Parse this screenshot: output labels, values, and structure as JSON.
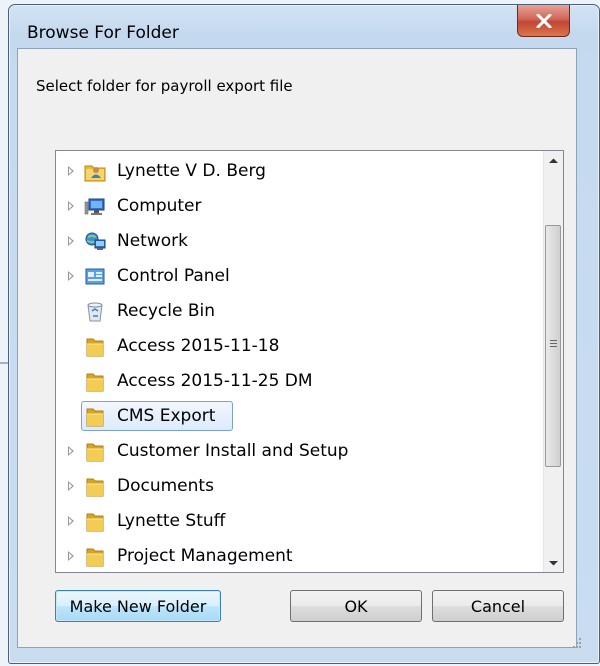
{
  "window": {
    "title": "Browse For Folder",
    "close_glyph": "X"
  },
  "prompt": "Select folder for payroll export file",
  "tree": {
    "items": [
      {
        "label": "Lynette V D. Berg",
        "icon": "user-folder-icon",
        "expandable": true,
        "selected": false
      },
      {
        "label": "Computer",
        "icon": "computer-icon",
        "expandable": true,
        "selected": false
      },
      {
        "label": "Network",
        "icon": "network-icon",
        "expandable": true,
        "selected": false
      },
      {
        "label": "Control Panel",
        "icon": "control-panel-icon",
        "expandable": true,
        "selected": false
      },
      {
        "label": "Recycle Bin",
        "icon": "recycle-bin-icon",
        "expandable": false,
        "selected": false
      },
      {
        "label": "Access 2015-11-18",
        "icon": "folder-icon",
        "expandable": false,
        "selected": false
      },
      {
        "label": "Access 2015-11-25 DM",
        "icon": "folder-icon",
        "expandable": false,
        "selected": false
      },
      {
        "label": "CMS Export",
        "icon": "folder-icon",
        "expandable": false,
        "selected": true
      },
      {
        "label": "Customer Install and Setup",
        "icon": "folder-icon",
        "expandable": true,
        "selected": false
      },
      {
        "label": "Documents",
        "icon": "folder-icon",
        "expandable": true,
        "selected": false
      },
      {
        "label": "Lynette Stuff",
        "icon": "folder-icon",
        "expandable": true,
        "selected": false
      },
      {
        "label": "Project Management",
        "icon": "folder-icon",
        "expandable": true,
        "selected": false
      }
    ]
  },
  "buttons": {
    "make_new_folder": "Make New Folder",
    "ok": "OK",
    "cancel": "Cancel"
  },
  "colors": {
    "selection_border": "#7da2ce",
    "folder_yellow": "#f0c94a",
    "close_red": "#c24634"
  }
}
